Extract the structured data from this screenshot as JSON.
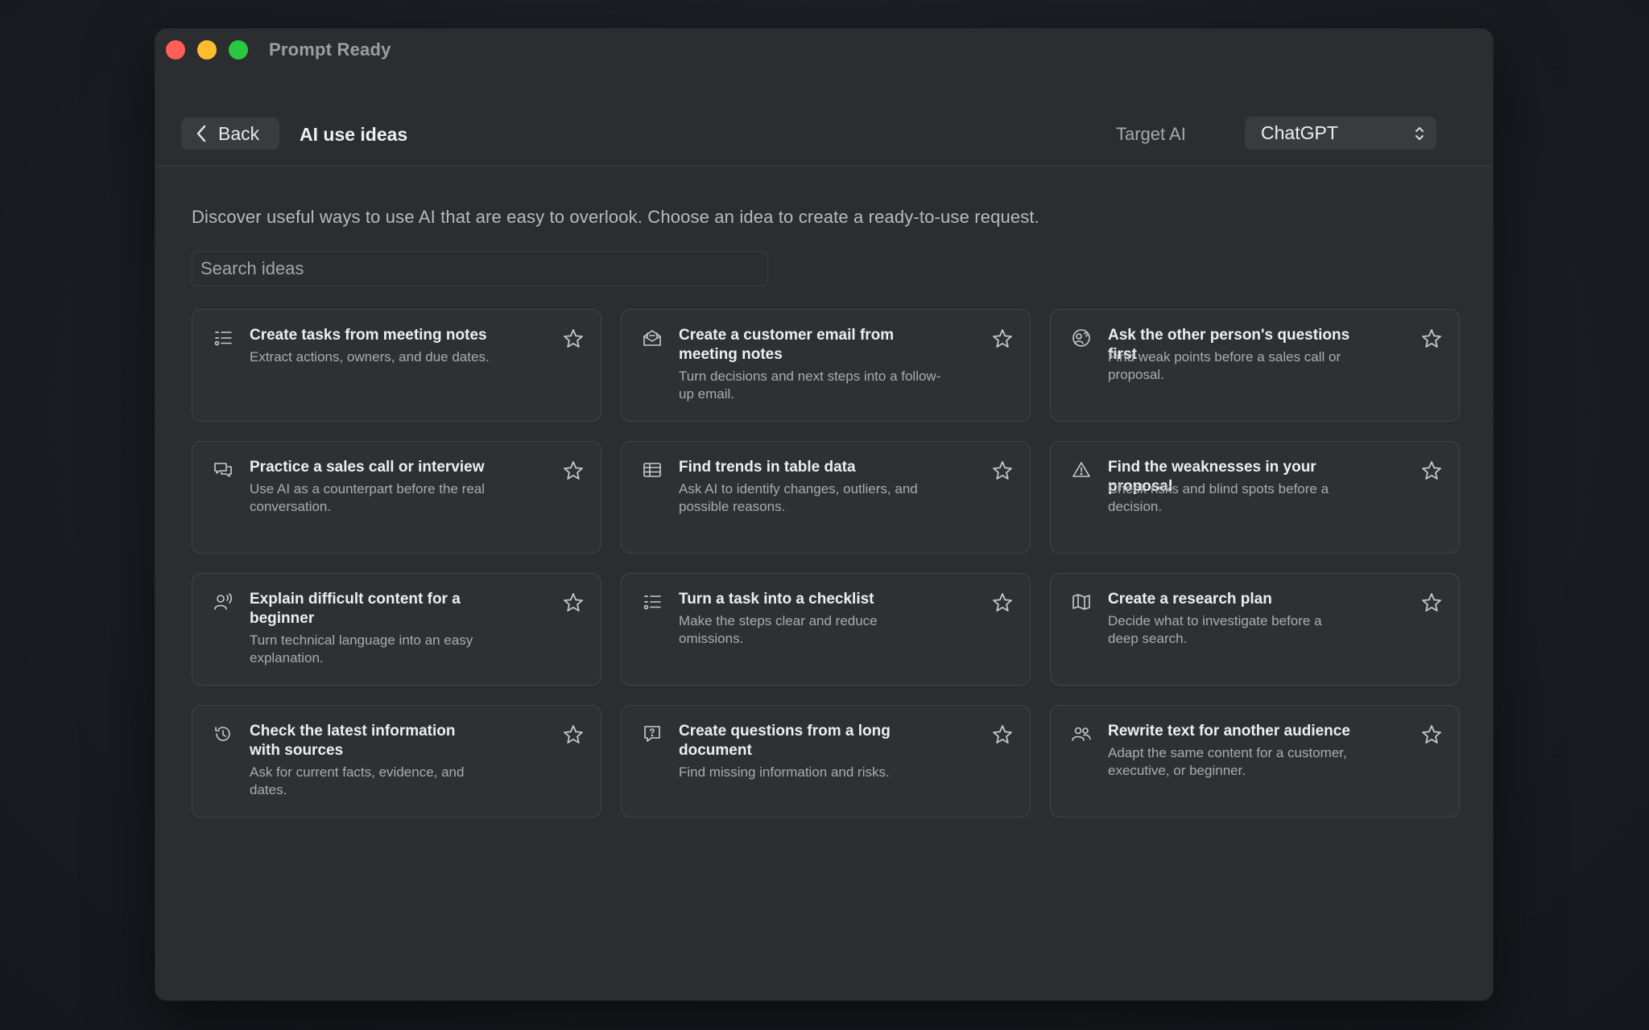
{
  "window": {
    "title": "Prompt Ready"
  },
  "toolbar": {
    "back_label": "Back",
    "page_title": "AI use ideas",
    "target_label": "Target AI",
    "target_value": "ChatGPT"
  },
  "intro": "Discover useful ways to use AI that are easy to overlook. Choose an idea to create a ready-to-use request.",
  "search": {
    "placeholder": "Search ideas",
    "value": ""
  },
  "ideas": [
    {
      "icon": "task-list-icon",
      "title": "Create tasks from meeting notes",
      "description": "Extract actions, owners, and due dates."
    },
    {
      "icon": "mail-open-icon",
      "title": "Create a customer email from meeting notes",
      "description": "Turn decisions and next steps into a follow-up email."
    },
    {
      "icon": "person-question-icon",
      "title": "Ask the other person's questions first",
      "description": "Find weak points before a sales call or proposal."
    },
    {
      "icon": "chat-bubbles-icon",
      "title": "Practice a sales call or interview",
      "description": "Use AI as a counterpart before the real conversation."
    },
    {
      "icon": "table-icon",
      "title": "Find trends in table data",
      "description": "Ask AI to identify changes, outliers, and possible reasons."
    },
    {
      "icon": "warning-icon",
      "title": "Find the weaknesses in your proposal",
      "description": "Check risks and blind spots before a decision."
    },
    {
      "icon": "person-speaking-icon",
      "title": "Explain difficult content for a beginner",
      "description": "Turn technical language into an easy explanation."
    },
    {
      "icon": "checklist-icon",
      "title": "Turn a task into a checklist",
      "description": "Make the steps clear and reduce omissions."
    },
    {
      "icon": "map-icon",
      "title": "Create a research plan",
      "description": "Decide what to investigate before a deep search."
    },
    {
      "icon": "history-icon",
      "title": "Check the latest information with sources",
      "description": "Ask for current facts, evidence, and dates."
    },
    {
      "icon": "question-bubble-icon",
      "title": "Create questions from a long document",
      "description": "Find missing information and risks."
    },
    {
      "icon": "people-icon",
      "title": "Rewrite text for another audience",
      "description": "Adapt the same content for a customer, executive, or beginner."
    }
  ]
}
